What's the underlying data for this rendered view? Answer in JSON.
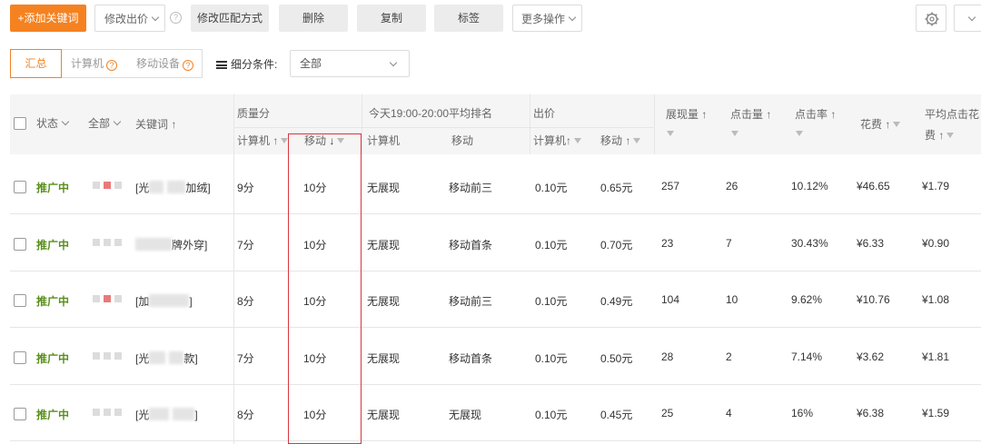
{
  "toolbar": {
    "add_keyword": "+添加关键词",
    "modify_bid": "修改出价",
    "modify_match": "修改匹配方式",
    "delete": "删除",
    "copy": "复制",
    "tag": "标签",
    "more_actions": "更多操作"
  },
  "tabs": {
    "summary": "汇总",
    "computer": "计算机",
    "mobile": "移动设备"
  },
  "filter": {
    "label": "细分条件:",
    "selected": "全部"
  },
  "table": {
    "headers": {
      "status": "状态",
      "all": "全部",
      "keyword": "关键词",
      "quality": "质量分",
      "quality_pc": "计算机",
      "quality_mobile": "移动",
      "rank_group": "今天19:00-20:00平均排名",
      "rank_pc": "计算机",
      "rank_mobile": "移动",
      "bid_group": "出价",
      "bid_pc": "计算机",
      "bid_mobile": "移动",
      "impressions": "展现量",
      "clicks": "点击量",
      "ctr": "点击率",
      "cost": "花费",
      "avg_cpc_line1": "平均点击花",
      "avg_cpc_line2": "费"
    },
    "rows": [
      {
        "status": "推广中",
        "kw_prefix": "[光",
        "kw_suffix": "加绒]",
        "q_pc": "9分",
        "q_mobile": "10分",
        "rank_pc": "无展现",
        "rank_mobile": "移动前三",
        "bid_pc": "0.10元",
        "bid_mobile": "0.65元",
        "impressions": "257",
        "clicks": "26",
        "ctr": "10.12%",
        "cost": "¥46.65",
        "cpc": "¥1.79"
      },
      {
        "status": "推广中",
        "kw_prefix": "",
        "kw_suffix": "牌外穿]",
        "q_pc": "7分",
        "q_mobile": "10分",
        "rank_pc": "无展现",
        "rank_mobile": "移动首条",
        "bid_pc": "0.10元",
        "bid_mobile": "0.70元",
        "impressions": "23",
        "clicks": "7",
        "ctr": "30.43%",
        "cost": "¥6.33",
        "cpc": "¥0.90"
      },
      {
        "status": "推广中",
        "kw_prefix": "[加",
        "kw_suffix": "]",
        "q_pc": "8分",
        "q_mobile": "10分",
        "rank_pc": "无展现",
        "rank_mobile": "移动前三",
        "bid_pc": "0.10元",
        "bid_mobile": "0.49元",
        "impressions": "104",
        "clicks": "10",
        "ctr": "9.62%",
        "cost": "¥10.76",
        "cpc": "¥1.08"
      },
      {
        "status": "推广中",
        "kw_prefix": "[光",
        "kw_suffix": "款]",
        "q_pc": "7分",
        "q_mobile": "10分",
        "rank_pc": "无展现",
        "rank_mobile": "移动首条",
        "bid_pc": "0.10元",
        "bid_mobile": "0.50元",
        "impressions": "28",
        "clicks": "2",
        "ctr": "7.14%",
        "cost": "¥3.62",
        "cpc": "¥1.81"
      },
      {
        "status": "推广中",
        "kw_prefix": "[光",
        "kw_suffix": "]",
        "q_pc": "8分",
        "q_mobile": "10分",
        "rank_pc": "无展现",
        "rank_mobile": "无展现",
        "bid_pc": "0.10元",
        "bid_mobile": "0.45元",
        "impressions": "25",
        "clicks": "4",
        "ctr": "16%",
        "cost": "¥6.38",
        "cpc": "¥1.59"
      }
    ]
  },
  "colors": {
    "accent": "#f58220",
    "status_green": "#5a8f1c",
    "highlight_red": "#d9363e"
  }
}
